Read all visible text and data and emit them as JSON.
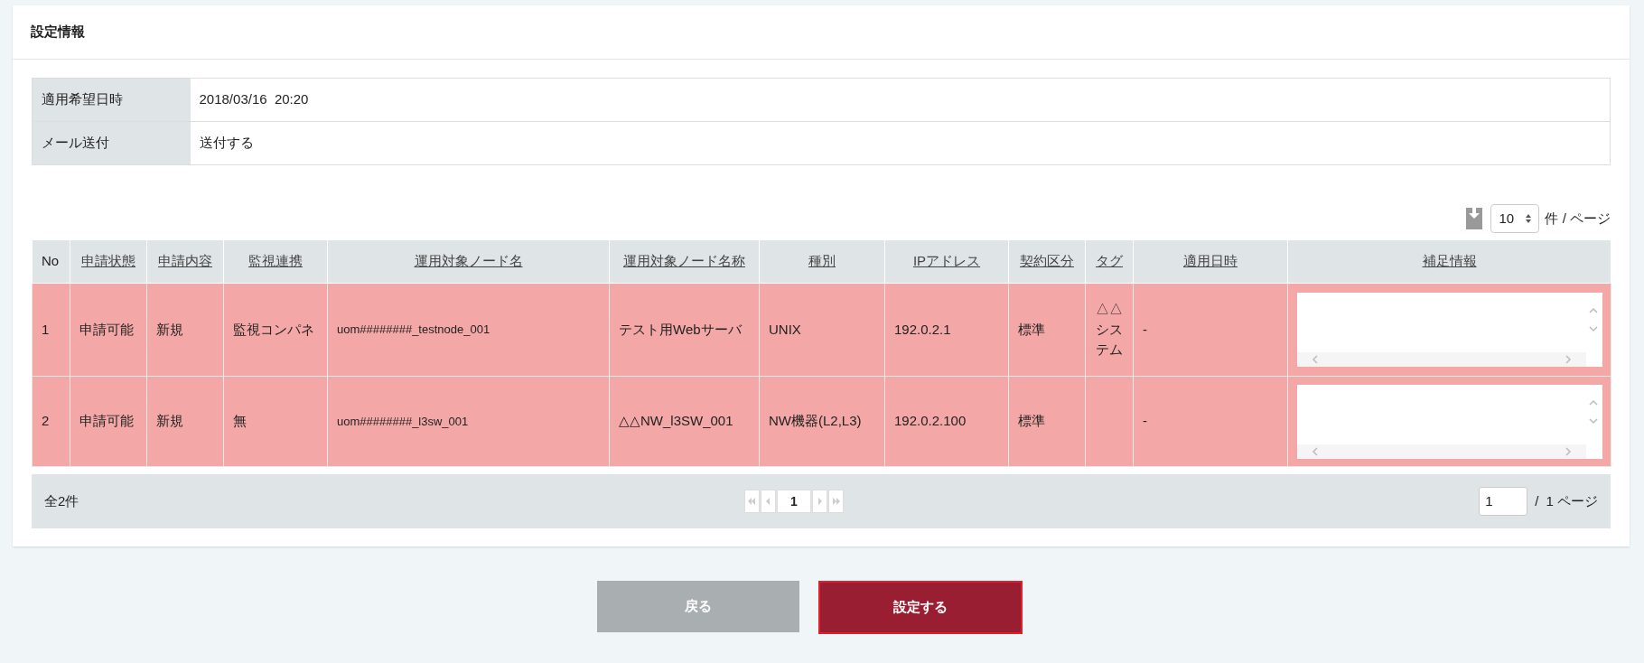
{
  "panel": {
    "title": "設定情報"
  },
  "info": [
    {
      "label": "適用希望日時",
      "value": "2018/03/16  20:20"
    },
    {
      "label": "メール送付",
      "value": "送付する"
    }
  ],
  "toolbar": {
    "per_page": "10",
    "per_page_unit": "件 / ページ"
  },
  "table": {
    "columns": [
      {
        "label": "No",
        "sortable": false
      },
      {
        "label": "申請状態",
        "sortable": true
      },
      {
        "label": "申請内容",
        "sortable": true
      },
      {
        "label": "監視連携",
        "sortable": true
      },
      {
        "label": "運用対象ノード名",
        "sortable": true
      },
      {
        "label": "運用対象ノード名称",
        "sortable": true
      },
      {
        "label": "種別",
        "sortable": true
      },
      {
        "label": "IPアドレス",
        "sortable": true
      },
      {
        "label": "契約区分",
        "sortable": true
      },
      {
        "label": "タグ",
        "sortable": true
      },
      {
        "label": "適用日時",
        "sortable": true
      },
      {
        "label": "補足情報",
        "sortable": true
      }
    ],
    "rows": [
      {
        "highlighted": true,
        "cells": [
          "1",
          "申請可能",
          "新規",
          "監視コンパネ",
          "uom########_testnode_001",
          "テスト用Webサーバ",
          "UNIX",
          "192.0.2.1",
          "標準",
          "△△システム",
          "-"
        ]
      },
      {
        "highlighted": true,
        "cells": [
          "2",
          "申請可能",
          "新規",
          "無",
          "uom########_l3sw_001",
          "△△NW_l3SW_001",
          "NW機器(L2,L3)",
          "192.0.2.100",
          "標準",
          "",
          "-"
        ]
      }
    ]
  },
  "pager": {
    "total": "全2件",
    "current": "1",
    "page_input": "1",
    "separator": "/",
    "pages": "1 ページ"
  },
  "buttons": {
    "back": "戻る",
    "submit": "設定する"
  }
}
